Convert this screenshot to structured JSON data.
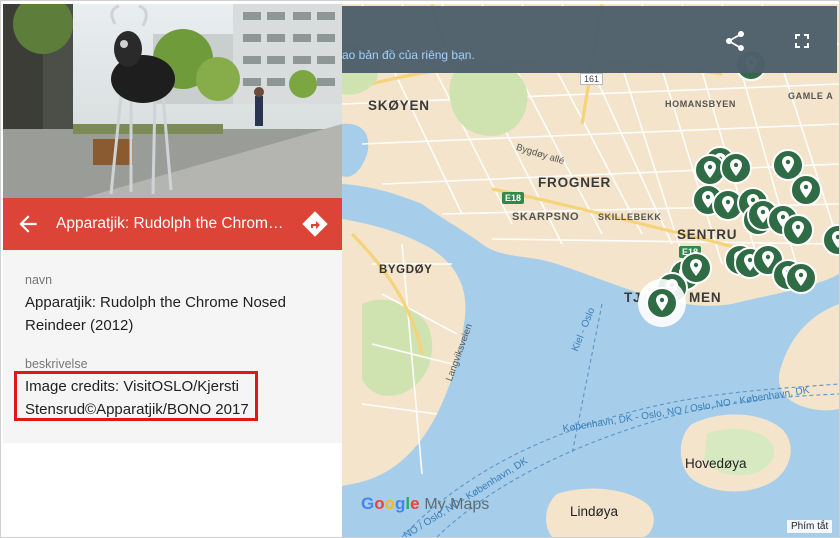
{
  "panel": {
    "title": "Apparatjik: Rudolph the Chrome Nosed Reindeer (2012)",
    "fields": [
      {
        "label": "navn",
        "value_line1": "Apparatjik: Rudolph the Chrome Nosed",
        "value_line2": "Reindeer (2012)"
      },
      {
        "label": "beskrivelse",
        "value_line1": "Image credits: VisitOSLO/Kjersti",
        "value_line2": "Stensrud©Apparatjik/BONO 2017"
      }
    ]
  },
  "map": {
    "banner": "ao bản đồ của riêng bạn.",
    "places": {
      "skoyen": "SKØYEN",
      "frogner": "FROGNER",
      "skarpsno": "SKARPSNO",
      "skillebekk": "SKILLEBEKK",
      "sentrum": "SENTRU",
      "bygdoy": "BYGDØY",
      "tjuvholmen_a": "TJ",
      "tjuvholmen_b": "MEN",
      "homansbyen": "HOMANSBYEN",
      "gamle": "GAMLE A"
    },
    "roads": {
      "bygdoy_alle": "Bygdøy allé",
      "langviksveien": "Langviksveien",
      "e18_a": "E18",
      "e18_b": "E18",
      "road161": "161"
    },
    "water": {
      "ferry1": "København, DK - Oslo, NO / Oslo, NO - København, DK",
      "ferry2": "Kiel - Oslo",
      "ferry3": "NO / Oslo, NO - København, DK"
    },
    "islands": {
      "hovedoya": "Hovedøya",
      "lindoya": "Lindøya"
    },
    "logo": {
      "google": "Google",
      "mymaps": "My Maps"
    },
    "shortcuts": "Phím tắt",
    "colors": {
      "accent": "#db4437",
      "pin": "#2f6b45",
      "water": "#a6cdea",
      "land": "#f3e4cb",
      "topbar": "#4e5f6a"
    }
  },
  "icons": {
    "back": "arrow-left-icon",
    "directions": "directions-icon",
    "share": "share-icon",
    "fullscreen": "fullscreen-icon",
    "pin": "map-pin-icon"
  }
}
